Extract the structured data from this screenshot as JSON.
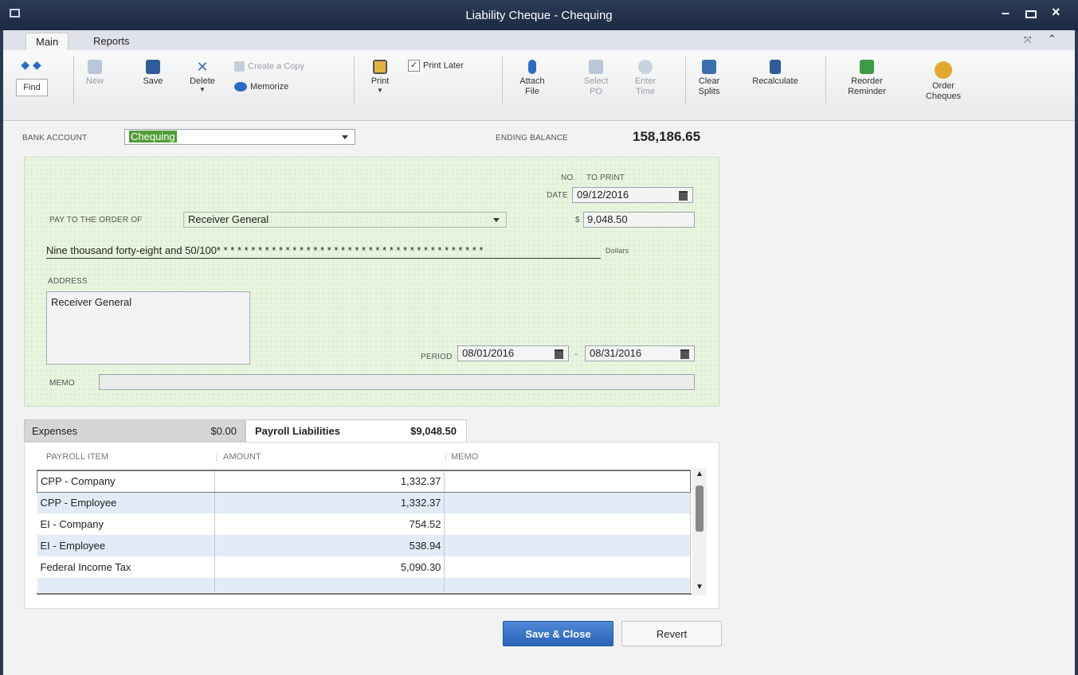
{
  "window": {
    "title": "Liability Cheque - Chequing"
  },
  "tabs": [
    "Main",
    "Reports"
  ],
  "toolbar": {
    "find": "Find",
    "new": "New",
    "save": "Save",
    "delete": "Delete",
    "create_copy": "Create a Copy",
    "memorize": "Memorize",
    "print": "Print",
    "print_later": "Print Later",
    "attach_file": [
      "Attach",
      "File"
    ],
    "select_po": [
      "Select",
      "PO"
    ],
    "enter_time": [
      "Enter",
      "Time"
    ],
    "clear_splits": [
      "Clear",
      "Splits"
    ],
    "recalculate": "Recalculate",
    "reorder_reminder": [
      "Reorder",
      "Reminder"
    ],
    "order_cheques": [
      "Order",
      "Cheques"
    ]
  },
  "account": {
    "bank_account_label": "BANK ACCOUNT",
    "bank_account": "Chequing",
    "ending_balance_label": "ENDING BALANCE",
    "ending_balance": "158,186.65"
  },
  "cheque": {
    "no_label": "NO.",
    "no_value": "TO PRINT",
    "date_label": "DATE",
    "date": "09/12/2016",
    "pay_to_label": "PAY TO THE ORDER OF",
    "payee": "Receiver General",
    "currency_symbol": "$",
    "amount": "9,048.50",
    "amount_words": "Nine thousand forty-eight and 50/100* * * * * * * * * * * * * * * * * * * * * * * * * * * * * * * * * * * * * * *",
    "dollars_label": "Dollars",
    "address_label": "ADDRESS",
    "address": "Receiver General",
    "period_label": "PERIOD",
    "period_from": "08/01/2016",
    "period_sep": "-",
    "period_to": "08/31/2016",
    "memo_label": "MEMO",
    "memo": ""
  },
  "detail_tabs": [
    {
      "label": "Expenses",
      "amount": "$0.00"
    },
    {
      "label": "Payroll Liabilities",
      "amount": "$9,048.50"
    }
  ],
  "grid": {
    "columns": [
      "PAYROLL ITEM",
      "AMOUNT",
      "MEMO"
    ],
    "rows": [
      {
        "item": "CPP - Company",
        "amount": "1,332.37",
        "memo": ""
      },
      {
        "item": "CPP - Employee",
        "amount": "1,332.37",
        "memo": ""
      },
      {
        "item": "EI - Company",
        "amount": "754.52",
        "memo": ""
      },
      {
        "item": "EI - Employee",
        "amount": "538.94",
        "memo": ""
      },
      {
        "item": "Federal Income Tax",
        "amount": "5,090.30",
        "memo": ""
      },
      {
        "item": "",
        "amount": "",
        "memo": ""
      }
    ]
  },
  "buttons": {
    "save_close": "Save & Close",
    "revert": "Revert"
  }
}
